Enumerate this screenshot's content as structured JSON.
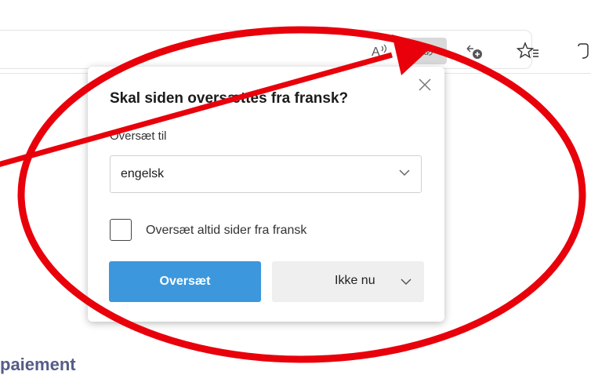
{
  "toolbar": {
    "read_aloud_icon_text": "A̧",
    "translate_icon_text": "☼あ",
    "collections_icon_text": "⊕",
    "favorites_icon_text": "☆",
    "extensions_icon_text": "⬡"
  },
  "popup": {
    "title": "Skal siden oversættes fra fransk?",
    "close_glyph": "✕",
    "translate_to_label": "Oversæt til",
    "selected_language": "engelsk",
    "always_translate_label": "Oversæt altid sider fra fransk",
    "always_translate_checked": false,
    "translate_button": "Oversæt",
    "not_now_button": "Ikke nu"
  },
  "page": {
    "partial_heading": "paiement"
  },
  "colors": {
    "accent": "#3c97dc",
    "annotation": "#e8000b"
  }
}
